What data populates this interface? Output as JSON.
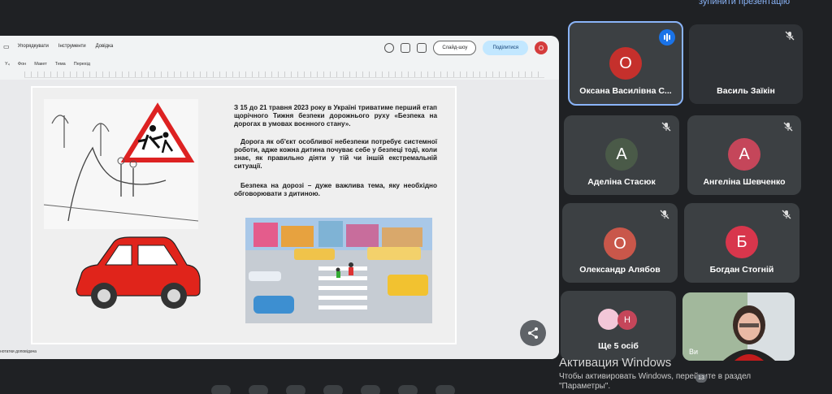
{
  "top_hint": "зупинити презентацію",
  "editor": {
    "menu": [
      "Упорядкувати",
      "Інструменти",
      "Довідка"
    ],
    "slideshow_label": "Слайд-шоу",
    "share_label": "Поділитися",
    "account_initial": "О",
    "toolbar": [
      "Фон",
      "Макет",
      "Тема",
      "Перехід"
    ],
    "bottom_label": "нотатки доповідача"
  },
  "slide": {
    "paragraph1": "З 15 до 21 травня 2023 року в Україні триватиме перший етап щорічного Тижня безпеки дорожнього руху «Безпека на дорогах в умовах воєнного стану».",
    "paragraph2": "Дорога як об'єкт особливої небезпеки потребує системної роботи, адже кожна дитина почуває себе у безпеці тоді, коли знає, як правильно діяти у тій чи іншій екстремальній ситуації.",
    "paragraph3": "Безпека на дорозі – дуже важлива тема, яку необхідно обговорювати з дитиною."
  },
  "participants": [
    {
      "name": "Оксана Василівна С...",
      "initial": "О",
      "color": "#c5302c",
      "active": true,
      "speaking": true
    },
    {
      "name": "Василь Заїкін",
      "initial": "",
      "color": "#3c4043",
      "active": false,
      "speaking": false
    },
    {
      "name": "Аделіна Стасюк",
      "initial": "А",
      "color": "#4a5a48",
      "active": false,
      "speaking": false
    },
    {
      "name": "Ангеліна Шевченко",
      "initial": "А",
      "color": "#c5465a",
      "active": false,
      "speaking": false
    },
    {
      "name": "Олександр Алябов",
      "initial": "О",
      "color": "#c9574a",
      "active": false,
      "speaking": false
    },
    {
      "name": "Богдан Стогній",
      "initial": "Б",
      "color": "#d8364c",
      "active": false,
      "speaking": false
    }
  ],
  "more_people": {
    "label": "Ще 5 осіб",
    "initial": "Н"
  },
  "self_view_label": "Ви",
  "windows_activation": {
    "title": "Активация Windows",
    "line1": "Чтобы активировать Windows, перейдите в раздел",
    "line2": "\"Параметры\"."
  },
  "participant_count": "13"
}
